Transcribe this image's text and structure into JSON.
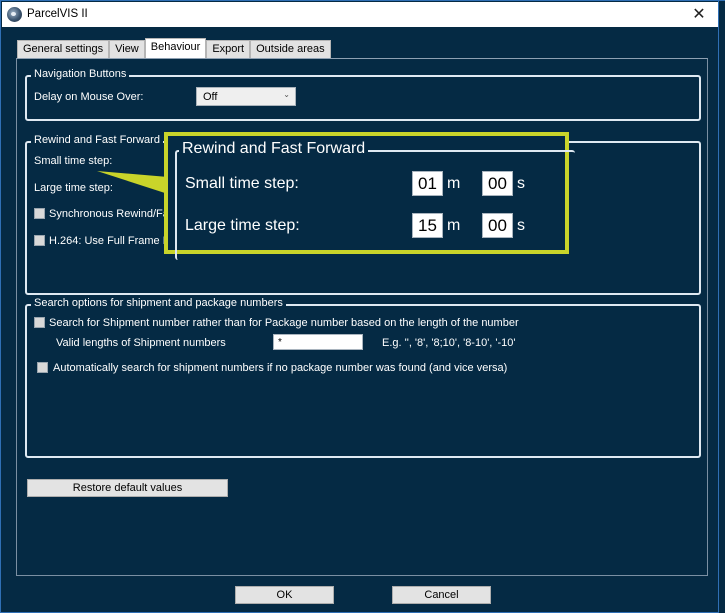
{
  "window": {
    "title": "ParcelVIS II",
    "icon": "app-logo-icon",
    "close_icon": "close-icon",
    "close_glyph": "✕"
  },
  "tabs": [
    {
      "label": "General settings",
      "active": false
    },
    {
      "label": "View",
      "active": false
    },
    {
      "label": "Behaviour",
      "active": true
    },
    {
      "label": "Export",
      "active": false
    },
    {
      "label": "Outside areas",
      "active": false
    }
  ],
  "navigation": {
    "legend": "Navigation Buttons",
    "delay_label": "Delay on Mouse Over:",
    "delay_value": "Off",
    "chevron_glyph": "⌄"
  },
  "rewind": {
    "legend": "Rewind and Fast Forward",
    "small_label": "Small time step:",
    "large_label": "Large time step:",
    "sync_label": "Synchronous Rewind/Fa",
    "h264_label": "H.264: Use Full Frame M",
    "sync_checked": false,
    "h264_checked": false
  },
  "callout": {
    "legend": "Rewind and Fast Forward",
    "small_label": "Small time step:",
    "large_label": "Large time step:",
    "small_minutes": "01",
    "small_seconds": "00",
    "large_minutes": "15",
    "large_seconds": "00",
    "minutes_unit": "m",
    "seconds_unit": "s",
    "highlight_color": "#c9d42a"
  },
  "search": {
    "legend": "Search options for shipment and package numbers",
    "shipment_check_label": "Search for Shipment number rather than for Package number based on the length of the number",
    "shipment_checked": false,
    "valid_lengths_label": "Valid lengths of Shipment numbers",
    "valid_lengths_value": "*",
    "example_text": "E.g. '', '8', '8;10', '8-10', '-10'",
    "auto_search_label": "Automatically search for shipment numbers if no package number was found (and vice versa)",
    "auto_checked": false
  },
  "buttons": {
    "restore": "Restore default values",
    "ok": "OK",
    "cancel": "Cancel"
  },
  "colors": {
    "background": "#052a44",
    "accent_border": "#2f6fb5",
    "highlight": "#c9d42a"
  }
}
